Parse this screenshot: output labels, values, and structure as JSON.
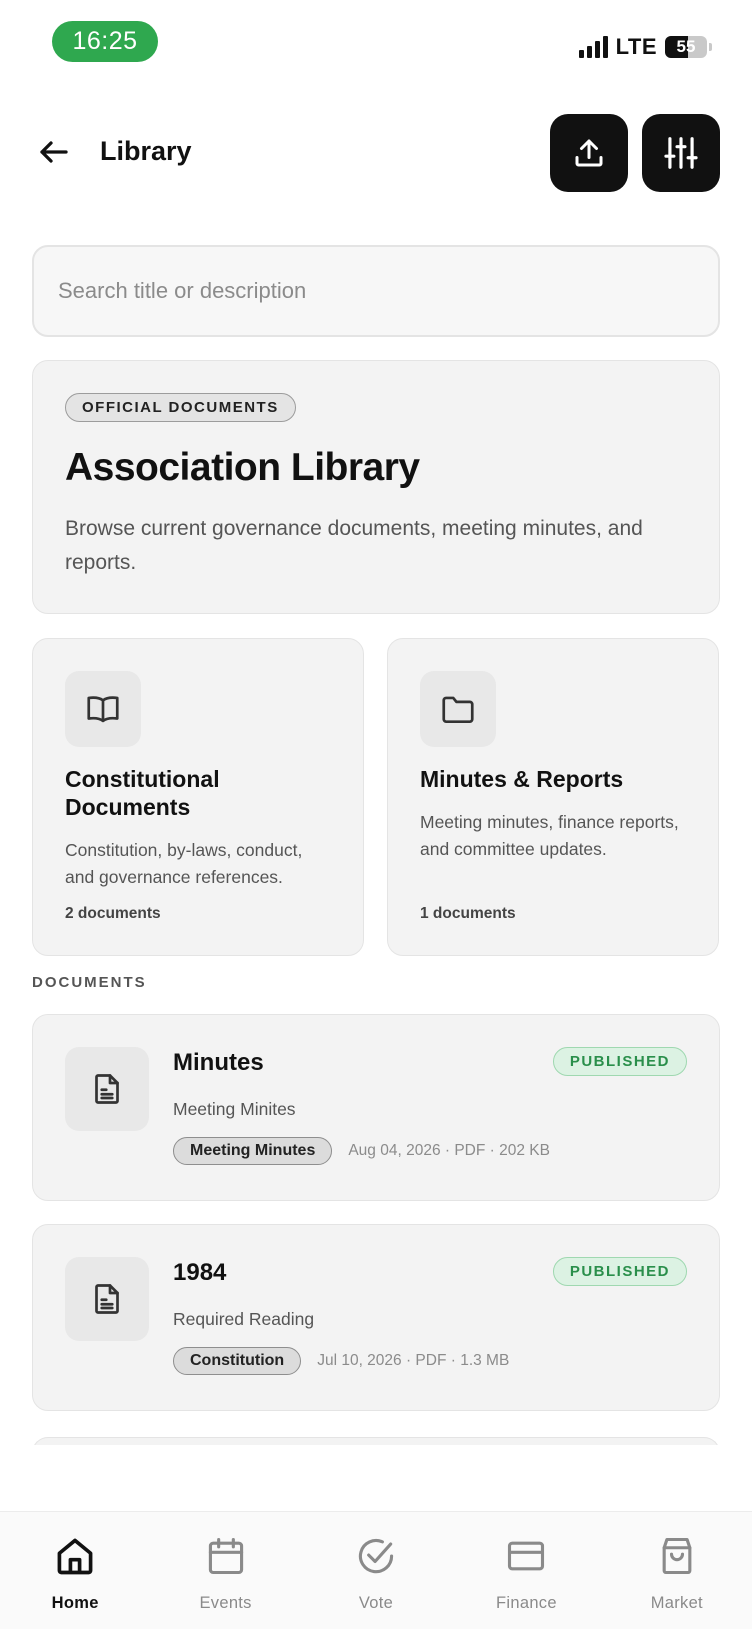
{
  "status_bar": {
    "time": "16:25",
    "network": "LTE",
    "battery": "55",
    "battery_level_pct": 55
  },
  "header": {
    "title": "Library",
    "back_icon": "arrow-left-icon",
    "upload_icon": "upload-icon",
    "filter_icon": "sliders-icon"
  },
  "search": {
    "placeholder": "Search title or description",
    "value": ""
  },
  "hero": {
    "tag": "OFFICIAL DOCUMENTS",
    "title": "Association Library",
    "description": "Browse current governance documents, meeting minutes, and reports."
  },
  "categories": [
    {
      "icon": "book-icon",
      "title": "Constitutional Documents",
      "description": "Constitution, by-laws, conduct, and governance references.",
      "count": "2 documents"
    },
    {
      "icon": "folder-icon",
      "title": "Minutes & Reports",
      "description": "Meeting minutes, finance reports, and committee updates.",
      "count": "1 documents"
    }
  ],
  "documents_label": "DOCUMENTS",
  "documents": [
    {
      "icon": "document-icon",
      "title": "Minutes",
      "status": "PUBLISHED",
      "description": "Meeting Minites",
      "category": "Meeting Minutes",
      "info": "Aug 04, 2026 · PDF · 202 KB"
    },
    {
      "icon": "document-icon",
      "title": "1984",
      "status": "PUBLISHED",
      "description": "Required Reading",
      "category": "Constitution",
      "info": "Jul 10, 2026 · PDF · 1.3 MB"
    }
  ],
  "nav": [
    {
      "label": "Home",
      "icon": "home-icon",
      "active": true
    },
    {
      "label": "Events",
      "icon": "calendar-icon",
      "active": false
    },
    {
      "label": "Vote",
      "icon": "check-circle-icon",
      "active": false
    },
    {
      "label": "Finance",
      "icon": "card-icon",
      "active": false
    },
    {
      "label": "Market",
      "icon": "shopping-bag-icon",
      "active": false
    }
  ],
  "colors": {
    "status_green": "#2fa84f",
    "published_green": "#2a8f4b",
    "primary_dark": "#111111"
  }
}
